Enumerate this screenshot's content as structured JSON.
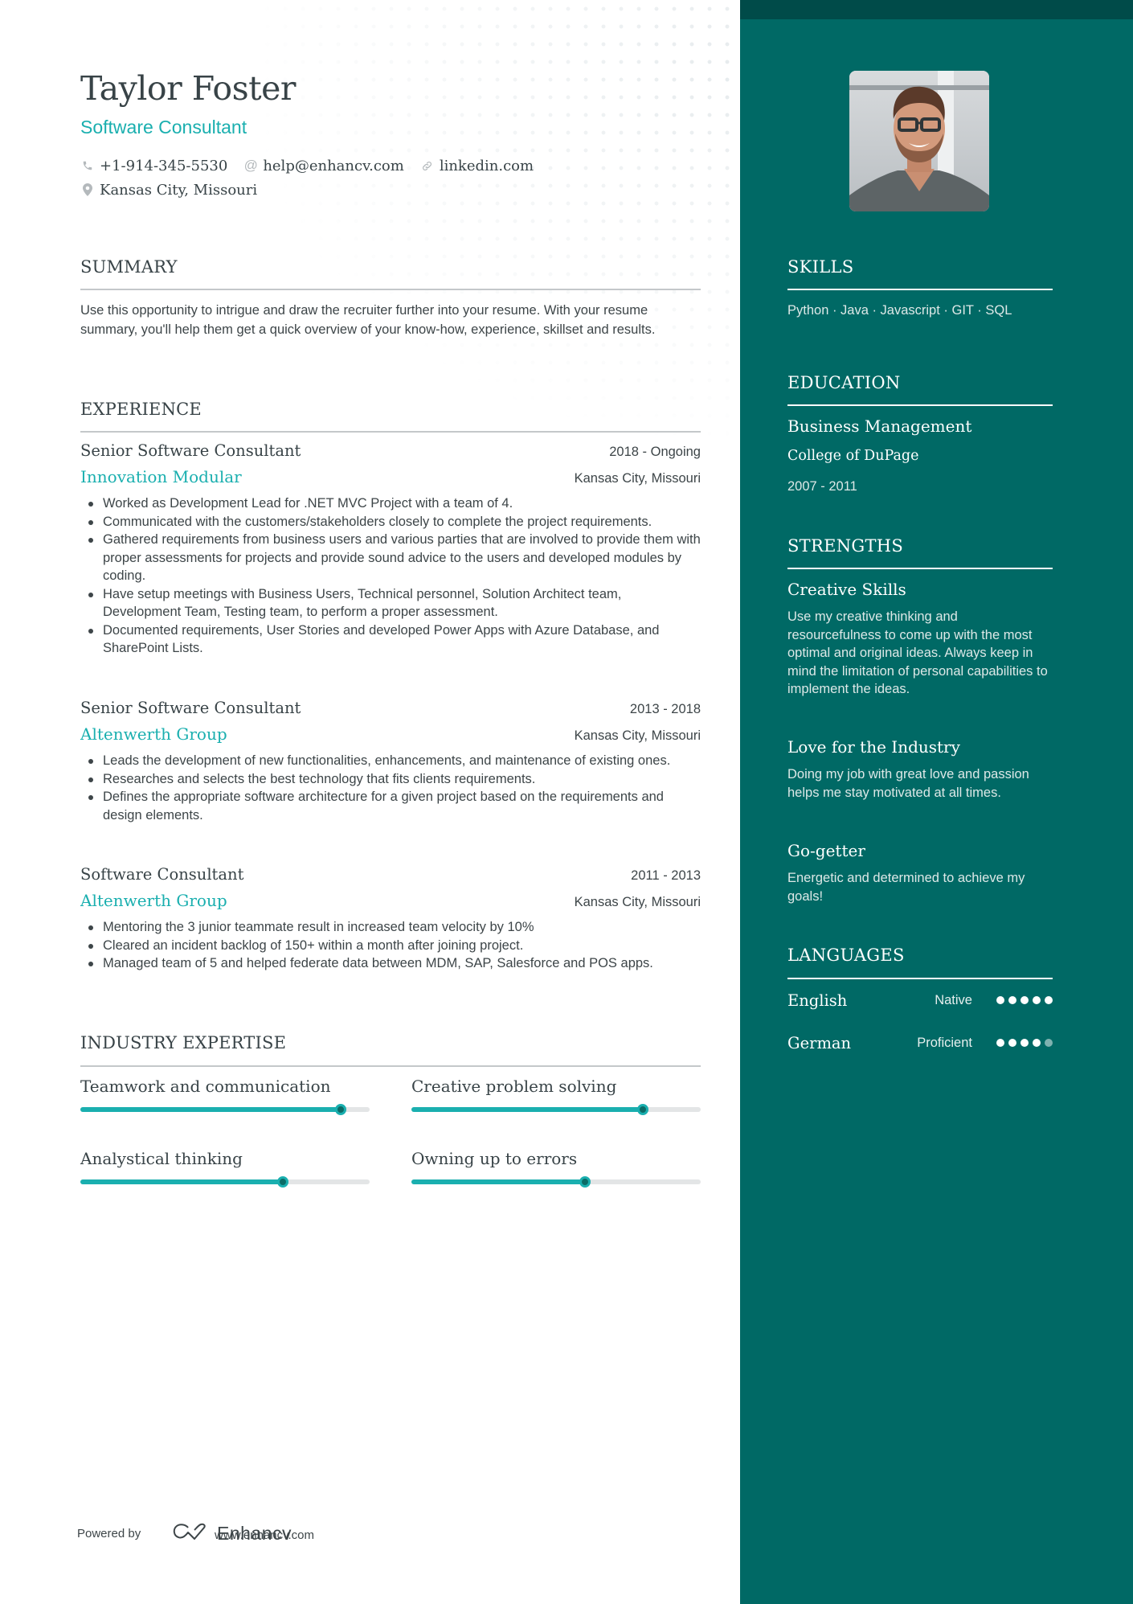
{
  "header": {
    "name": "Taylor Foster",
    "title": "Software Consultant",
    "contacts": [
      {
        "icon": "phone-icon",
        "value": "+1-914-345-5530"
      },
      {
        "icon": "at-icon",
        "value": "help@enhancv.com"
      },
      {
        "icon": "link-icon",
        "value": "linkedin.com"
      },
      {
        "icon": "location-pin-icon",
        "value": "Kansas City, Missouri"
      }
    ]
  },
  "summary": {
    "heading": "SUMMARY",
    "text": "Use this opportunity to intrigue and draw the recruiter further into your resume. With your resume summary, you'll help them get a quick overview of your know-how, experience, skillset and results."
  },
  "experience": {
    "heading": "EXPERIENCE",
    "jobs": [
      {
        "role": "Senior Software Consultant",
        "dates": "2018 - Ongoing",
        "company": "Innovation Modular",
        "location": "Kansas City, Missouri",
        "bullets": [
          "Worked as Development Lead for .NET MVC Project with a team of 4.",
          "Communicated with the customers/stakeholders closely to complete the project requirements.",
          "Gathered requirements from business users and various parties that are involved to provide them with proper assessments for projects and provide sound advice to the users and developed modules by coding.",
          "Have setup meetings with Business Users, Technical personnel, Solution Architect team, Development Team, Testing team, to perform a proper assessment.",
          "Documented requirements, User Stories and developed Power Apps with Azure Database, and SharePoint Lists."
        ]
      },
      {
        "role": "Senior Software Consultant",
        "dates": "2013 - 2018",
        "company": "Altenwerth Group",
        "location": "Kansas City, Missouri",
        "bullets": [
          "Leads the development of new functionalities, enhancements, and maintenance of existing ones.",
          "Researches and selects the best technology that fits clients requirements.",
          "Defines the appropriate software architecture for a given project based on the requirements and design elements."
        ]
      },
      {
        "role": "Software Consultant",
        "dates": "2011 - 2013",
        "company": "Altenwerth Group",
        "location": "Kansas City, Missouri",
        "bullets": [
          "Mentoring the 3 junior teammate result in increased team velocity by 10%",
          "Cleared an incident backlog of 150+ within a month after joining project.",
          "Managed team of 5 and helped federate data between MDM, SAP, Salesforce and POS apps."
        ]
      }
    ]
  },
  "industry_expertise": {
    "heading": "INDUSTRY EXPERTISE",
    "items": [
      {
        "label": "Teamwork and communication",
        "level": 0.9
      },
      {
        "label": "Creative problem solving",
        "level": 0.8
      },
      {
        "label": "Analystical thinking",
        "level": 0.7
      },
      {
        "label": "Owning up to errors",
        "level": 0.6
      }
    ]
  },
  "footer": {
    "powered_by": "Powered by",
    "brand": "Enhancv",
    "url": "www.enhancv.com"
  },
  "sidebar": {
    "photo_alt": "Profile photo",
    "skills": {
      "heading": "SKILLS",
      "text": "Python · Java · Javascript · GIT · SQL"
    },
    "education": {
      "heading": "EDUCATION",
      "degree": "Business Management",
      "school": "College of DuPage",
      "dates": "2007 - 2011"
    },
    "strengths": {
      "heading": "STRENGTHS",
      "items": [
        {
          "title": "Creative Skills",
          "text": "Use my creative thinking and resourcefulness to come up with the most optimal and original ideas. Always keep in mind the limitation of personal capabilities to implement the ideas."
        },
        {
          "title": "Love for the Industry",
          "text": "Doing my job with great love and passion helps me stay motivated at all times."
        },
        {
          "title": "Go-getter",
          "text": "Energetic and determined to achieve my goals!"
        }
      ]
    },
    "languages": {
      "heading": "LANGUAGES",
      "items": [
        {
          "name": "English",
          "level": "Native",
          "rating": 5,
          "max": 5
        },
        {
          "name": "German",
          "level": "Proficient",
          "rating": 4,
          "max": 5
        }
      ]
    }
  },
  "colors": {
    "accent": "#1aafaf",
    "sidebar_bg": "#006965",
    "sidebar_top": "#004b49",
    "text": "#384347"
  }
}
